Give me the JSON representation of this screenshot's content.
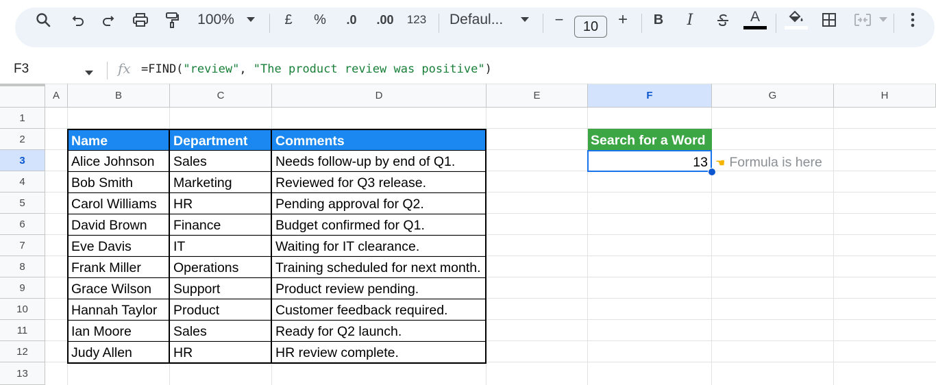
{
  "toolbar": {
    "zoom": "100%",
    "currency": "£",
    "percent": "%",
    "decrease_decimal": ".0",
    "increase_decimal": ".00",
    "number_format": "123",
    "font": "Defaul...",
    "minus": "−",
    "font_size": "10",
    "plus": "+",
    "bold": "B",
    "italic": "I",
    "text_color": "A"
  },
  "formula_bar": {
    "cell_ref": "F3",
    "fx": "fx",
    "prefix": "=FIND(",
    "arg1": "\"review\"",
    "sep": ", ",
    "arg2": "\"The product review was positive\"",
    "suffix": ")"
  },
  "columns": [
    "A",
    "B",
    "C",
    "D",
    "E",
    "F",
    "G",
    "H"
  ],
  "rows": [
    "1",
    "2",
    "3",
    "4",
    "5",
    "6",
    "7",
    "8",
    "9",
    "10",
    "11",
    "12",
    "13"
  ],
  "table": {
    "headers": [
      "Name",
      "Department",
      "Comments"
    ],
    "rows": [
      [
        "Alice Johnson",
        "Sales",
        "Needs follow-up by end of Q1."
      ],
      [
        "Bob Smith",
        "Marketing",
        "Reviewed for Q3 release."
      ],
      [
        "Carol Williams",
        "HR",
        "Pending approval for Q2."
      ],
      [
        "David Brown",
        "Finance",
        "Budget confirmed for Q1."
      ],
      [
        "Eve Davis",
        "IT",
        "Waiting for IT clearance."
      ],
      [
        "Frank Miller",
        "Operations",
        "Training scheduled for next month."
      ],
      [
        "Grace Wilson",
        "Support",
        "Product review pending."
      ],
      [
        "Hannah Taylor",
        "Product",
        "Customer feedback required."
      ],
      [
        "Ian Moore",
        "Sales",
        "Ready for Q2 launch."
      ],
      [
        "Judy Allen",
        "HR",
        "HR review complete."
      ]
    ]
  },
  "search": {
    "header": "Search for a Word",
    "result": "13",
    "note": "Formula is here",
    "pointer": "☚"
  },
  "colors": {
    "table_header": "#1a88f0",
    "search_header": "#3ca544",
    "selection": "#1a73e8"
  }
}
